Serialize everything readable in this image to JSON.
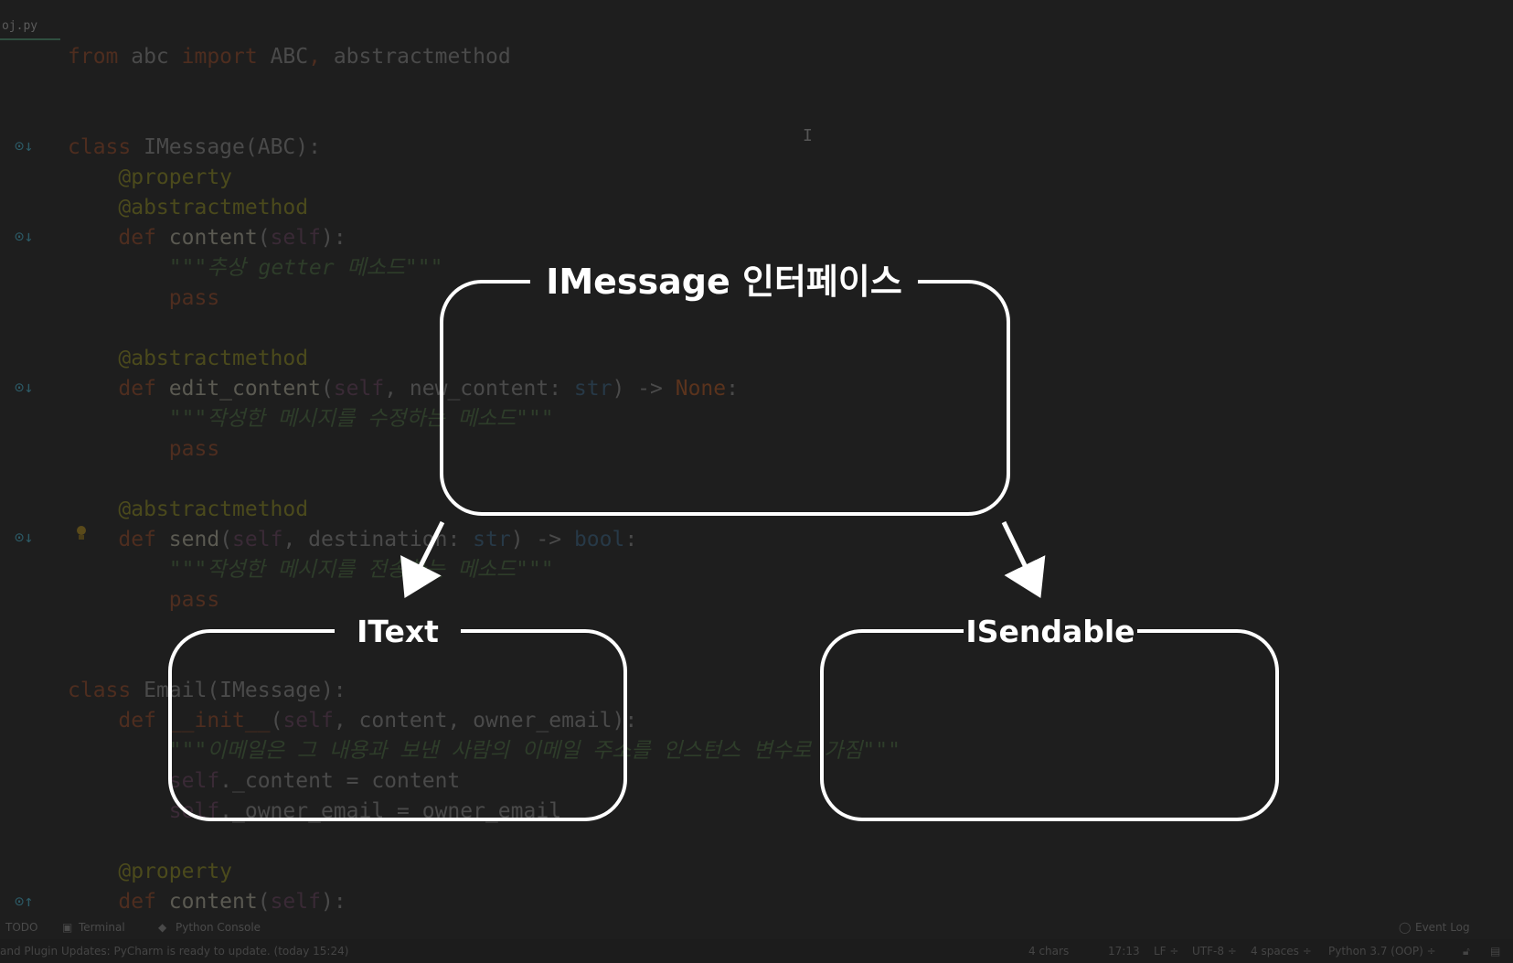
{
  "editor": {
    "tab_label": "oj.py",
    "code_lines": [
      [
        [
          "kw",
          "from"
        ],
        [
          "t",
          " abc "
        ],
        [
          "kw",
          "import"
        ],
        [
          "t",
          " ABC"
        ],
        [
          "kw",
          ","
        ],
        [
          "t",
          " abstractmethod"
        ]
      ],
      [],
      [],
      [
        [
          "kw",
          "class"
        ],
        [
          "t",
          " IMessage(ABC):"
        ]
      ],
      [
        [
          "t",
          "    "
        ],
        [
          "dec",
          "@property"
        ]
      ],
      [
        [
          "t",
          "    "
        ],
        [
          "dec",
          "@abstractmethod"
        ]
      ],
      [
        [
          "t",
          "    "
        ],
        [
          "kw",
          "def"
        ],
        [
          "fn",
          " content"
        ],
        [
          "t",
          "("
        ],
        [
          "sf",
          "self"
        ],
        [
          "t",
          "):"
        ]
      ],
      [
        [
          "t",
          "        "
        ],
        [
          "str",
          "\"\"\"추상 getter 메소드\"\"\""
        ]
      ],
      [
        [
          "t",
          "        "
        ],
        [
          "kw",
          "pass"
        ]
      ],
      [],
      [
        [
          "t",
          "    "
        ],
        [
          "dec",
          "@abstractmethod"
        ]
      ],
      [
        [
          "t",
          "    "
        ],
        [
          "kw",
          "def"
        ],
        [
          "fn",
          " edit_content"
        ],
        [
          "t",
          "("
        ],
        [
          "sf",
          "self"
        ],
        [
          "t",
          ", new_content: "
        ],
        [
          "typ",
          "str"
        ],
        [
          "t",
          ") -> "
        ],
        [
          "none",
          "None"
        ],
        [
          "t",
          ":"
        ]
      ],
      [
        [
          "t",
          "        "
        ],
        [
          "str",
          "\"\"\"작성한 메시지를 수정하는 메소드\"\"\""
        ]
      ],
      [
        [
          "t",
          "        "
        ],
        [
          "kw",
          "pass"
        ]
      ],
      [],
      [
        [
          "t",
          "    "
        ],
        [
          "dec",
          "@abstractmethod"
        ]
      ],
      [
        [
          "t",
          "    "
        ],
        [
          "kw",
          "def"
        ],
        [
          "fn",
          " send"
        ],
        [
          "t",
          "("
        ],
        [
          "sf",
          "self"
        ],
        [
          "t",
          ", destination: "
        ],
        [
          "typ",
          "str"
        ],
        [
          "t",
          ") -> "
        ],
        [
          "typ",
          "bool"
        ],
        [
          "t",
          ":"
        ]
      ],
      [
        [
          "t",
          "        "
        ],
        [
          "str",
          "\"\"\"작성한 메시지를 전송하는 메소드\"\"\""
        ]
      ],
      [
        [
          "t",
          "        "
        ],
        [
          "kw",
          "pass"
        ]
      ],
      [],
      [],
      [
        [
          "kw",
          "class"
        ],
        [
          "t",
          " Email(IMessage):"
        ]
      ],
      [
        [
          "t",
          "    "
        ],
        [
          "kw",
          "def"
        ],
        [
          "t",
          " "
        ],
        [
          "kw",
          "__init__"
        ],
        [
          "t",
          "("
        ],
        [
          "sf",
          "self"
        ],
        [
          "t",
          ", content, owner_email):"
        ]
      ],
      [
        [
          "t",
          "        "
        ],
        [
          "str",
          "\"\"\"이메일은 그 내용과 보낸 사람의 이메일 주소를 인스턴스 변수로 가짐\"\"\""
        ]
      ],
      [
        [
          "t",
          "        "
        ],
        [
          "sf",
          "self"
        ],
        [
          "t",
          "._content = content"
        ]
      ],
      [
        [
          "t",
          "        "
        ],
        [
          "sf",
          "self"
        ],
        [
          "t",
          "._owner_email = owner_email"
        ]
      ],
      [],
      [
        [
          "t",
          "    "
        ],
        [
          "dec",
          "@property"
        ]
      ],
      [
        [
          "t",
          "    "
        ],
        [
          "kw",
          "def"
        ],
        [
          "fn",
          " content"
        ],
        [
          "t",
          "("
        ],
        [
          "sf",
          "self"
        ],
        [
          "t",
          "):"
        ]
      ]
    ]
  },
  "toolwindows": {
    "todo": "TODO",
    "terminal": "Terminal",
    "python_console": "Python Console",
    "event_log": "Event Log"
  },
  "statusbar": {
    "message": "and Plugin Updates: PyCharm is ready to update. (today 15:24)",
    "chars": "4 chars",
    "position": "17:13",
    "line_sep": "LF ÷",
    "encoding": "UTF-8 ÷",
    "indent": "4 spaces ÷",
    "interpreter": "Python 3.7 (OOP) ÷"
  },
  "diagram": {
    "top_title": "IMessage 인터페이스",
    "left_title": "IText",
    "right_title": "ISendable"
  }
}
